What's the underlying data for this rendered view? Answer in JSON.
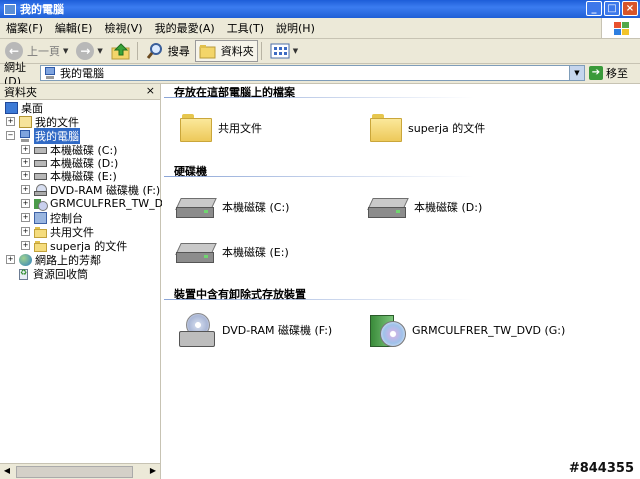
{
  "window": {
    "title": "我的電腦"
  },
  "menu": [
    "檔案(F)",
    "編輯(E)",
    "檢視(V)",
    "我的最愛(A)",
    "工具(T)",
    "說明(H)"
  ],
  "toolbar": {
    "back_label": "上一頁",
    "search_label": "搜尋",
    "folders_label": "資料夾"
  },
  "address": {
    "label": "網址(D)",
    "value": "我的電腦",
    "go_label": "移至"
  },
  "folders_pane": {
    "title": "資料夾",
    "close_glyph": "×",
    "tree": [
      {
        "label": "桌面",
        "icon": "desktop-icon",
        "expander": "",
        "selected": false
      },
      {
        "label": "我的文件",
        "icon": "my-documents-icon",
        "expander": "+",
        "selected": false
      },
      {
        "label": "我的電腦",
        "icon": "my-computer-icon",
        "expander": "−",
        "selected": true
      },
      {
        "label": "本機磁碟 (C:)",
        "icon": "hard-drive-icon",
        "expander": "+",
        "selected": false
      },
      {
        "label": "本機磁碟 (D:)",
        "icon": "hard-drive-icon",
        "expander": "+",
        "selected": false
      },
      {
        "label": "本機磁碟 (E:)",
        "icon": "hard-drive-icon",
        "expander": "+",
        "selected": false
      },
      {
        "label": "DVD-RAM 磁碟機 (F:)",
        "icon": "dvd-ram-drive-icon",
        "expander": "+",
        "selected": false
      },
      {
        "label": "GRMCULFRER_TW_DVD",
        "icon": "dvd-disc-icon",
        "expander": "+",
        "selected": false
      },
      {
        "label": "控制台",
        "icon": "control-panel-icon",
        "expander": "+",
        "selected": false
      },
      {
        "label": "共用文件",
        "icon": "folder-icon",
        "expander": "+",
        "selected": false
      },
      {
        "label": "superja 的文件",
        "icon": "folder-icon",
        "expander": "+",
        "selected": false
      },
      {
        "label": "網路上的芳鄰",
        "icon": "network-places-icon",
        "expander": "+",
        "selected": false
      },
      {
        "label": "資源回收筒",
        "icon": "recycle-bin-icon",
        "expander": "",
        "selected": false
      }
    ]
  },
  "content": {
    "sections": [
      {
        "title": "存放在這部電腦上的檔案",
        "items": [
          {
            "label": "共用文件",
            "icon": "folder-icon"
          },
          {
            "label": "superja 的文件",
            "icon": "folder-icon"
          }
        ]
      },
      {
        "title": "硬碟機",
        "items": [
          {
            "label": "本機磁碟 (C:)",
            "icon": "hard-drive-icon"
          },
          {
            "label": "本機磁碟 (D:)",
            "icon": "hard-drive-icon"
          },
          {
            "label": "本機磁碟 (E:)",
            "icon": "hard-drive-icon"
          }
        ]
      },
      {
        "title": "裝置中含有卸除式存放裝置",
        "items": [
          {
            "label": "DVD-RAM 磁碟機 (F:)",
            "icon": "dvd-ram-drive-icon"
          },
          {
            "label": "GRMCULFRER_TW_DVD (G:)",
            "icon": "dvd-disc-icon"
          }
        ]
      }
    ]
  },
  "watermark": "#844355"
}
